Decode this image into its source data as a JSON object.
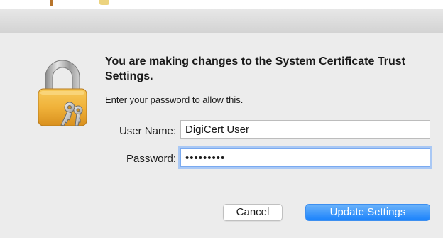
{
  "dialog": {
    "heading": "You are making changes to the System Certificate Trust Settings.",
    "subtext": "Enter your password to allow this.",
    "icon": "padlock-with-keys-icon"
  },
  "form": {
    "user_name_label": "User Name:",
    "user_name_value": "DigiCert User",
    "password_label": "Password:",
    "password_value": "•••••••••"
  },
  "buttons": {
    "cancel_label": "Cancel",
    "update_label": "Update Settings"
  },
  "colors": {
    "accent": "#1a82fb",
    "focus_ring": "#a9c8f5",
    "lock_body": "#f0b23a"
  }
}
